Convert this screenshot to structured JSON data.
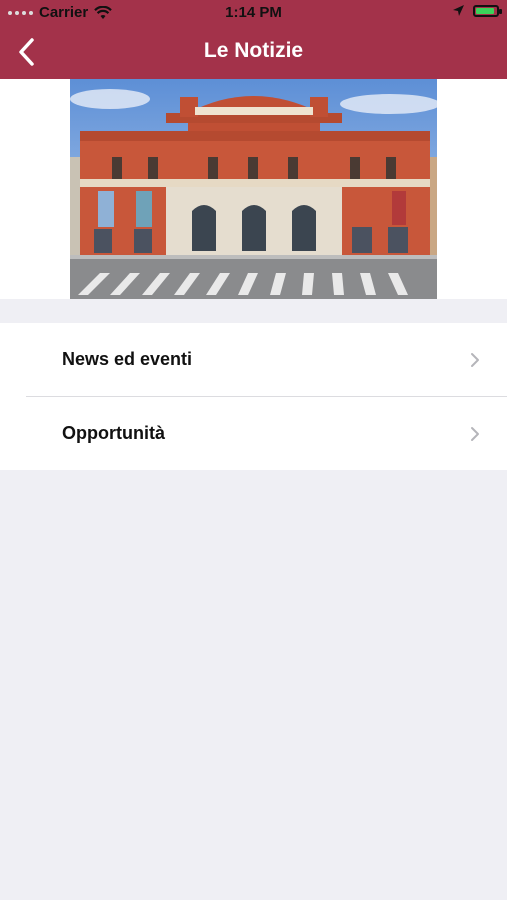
{
  "status_bar": {
    "carrier": "Carrier",
    "time": "1:14 PM",
    "battery_level": 0.8,
    "icons": [
      "signal-dots-icon",
      "wifi-icon",
      "location-arrow-icon",
      "battery-charging-icon"
    ]
  },
  "navbar": {
    "title": "Le Notizie",
    "back_icon": "chevron-left-icon",
    "background": "#a3324a"
  },
  "hero": {
    "alt": "Teatro Petruzzelli facade"
  },
  "menu": {
    "items": [
      {
        "label": "News ed eventi",
        "icon": "chevron-right-icon"
      },
      {
        "label": "Opportunità",
        "icon": "chevron-right-icon"
      }
    ]
  }
}
